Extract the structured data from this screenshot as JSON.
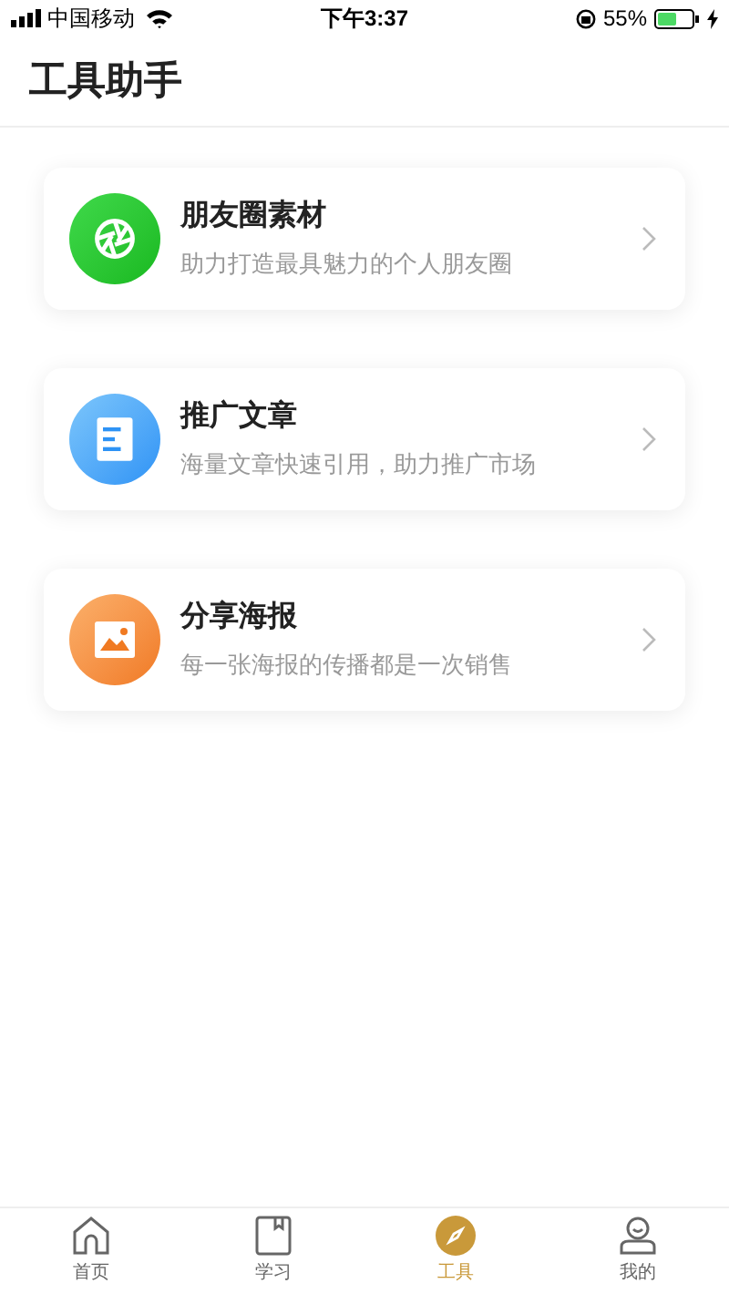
{
  "status_bar": {
    "carrier": "中国移动",
    "time": "下午3:37",
    "battery": "55%"
  },
  "header": {
    "title": "工具助手"
  },
  "cards": [
    {
      "kind": "moments",
      "title": "朋友圈素材",
      "subtitle": "助力打造最具魅力的个人朋友圈"
    },
    {
      "kind": "article",
      "title": "推广文章",
      "subtitle": "海量文章快速引用，助力推广市场"
    },
    {
      "kind": "poster",
      "title": "分享海报",
      "subtitle": "每一张海报的传播都是一次销售"
    }
  ],
  "tab_bar": [
    {
      "kind": "home",
      "label": "首页",
      "selected": false
    },
    {
      "kind": "study",
      "label": "学习",
      "selected": false
    },
    {
      "kind": "tools",
      "label": "工具",
      "selected": true
    },
    {
      "kind": "me",
      "label": "我的",
      "selected": false
    }
  ]
}
